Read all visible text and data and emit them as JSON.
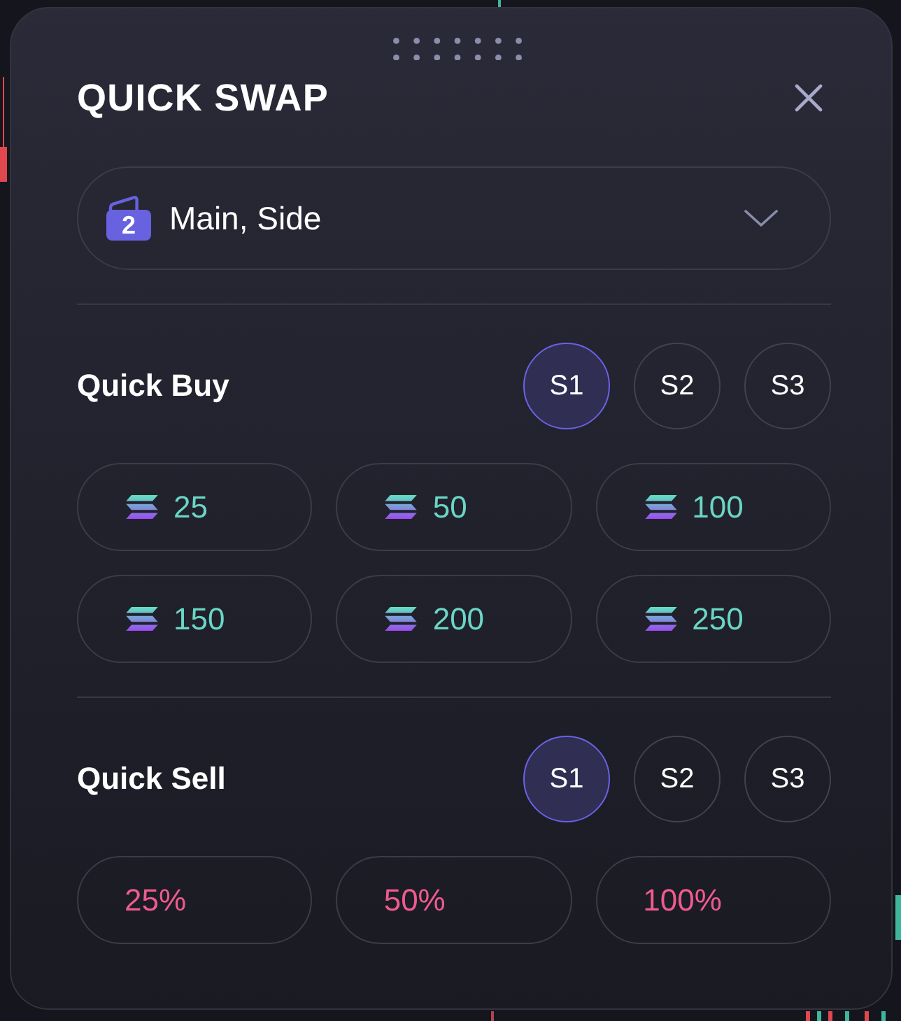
{
  "window": {
    "title": "QUICK SWAP"
  },
  "wallet_select": {
    "count": "2",
    "value": "Main, Side"
  },
  "sections": [
    {
      "kind": "buy",
      "title": "Quick Buy",
      "presets": [
        {
          "label": "S1",
          "selected": true
        },
        {
          "label": "S2",
          "selected": false
        },
        {
          "label": "S3",
          "selected": false
        }
      ],
      "amounts": [
        "25",
        "50",
        "100",
        "150",
        "200",
        "250"
      ]
    },
    {
      "kind": "sell",
      "title": "Quick Sell",
      "presets": [
        {
          "label": "S1",
          "selected": true
        },
        {
          "label": "S2",
          "selected": false
        },
        {
          "label": "S3",
          "selected": false
        }
      ],
      "amounts": [
        "25%",
        "50%",
        "100%"
      ]
    }
  ]
}
